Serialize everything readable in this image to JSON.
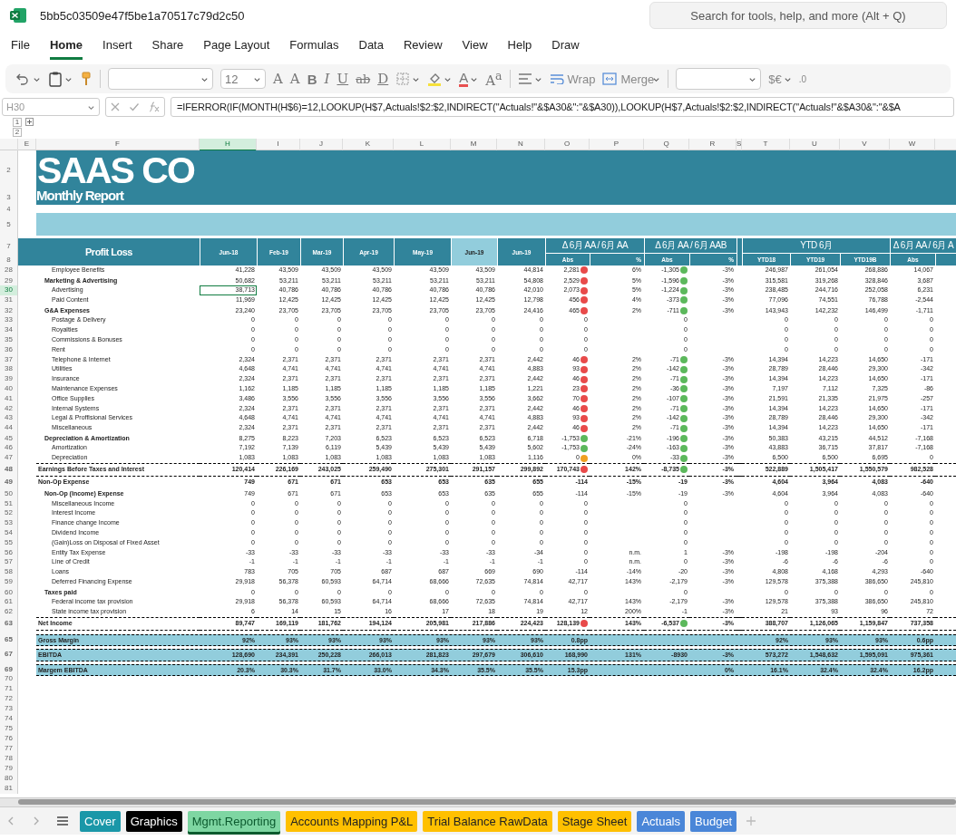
{
  "app": {
    "file_name": "5bb5c03509e47f5be1a70517c79d2c50",
    "search_placeholder": "Search for tools, help, and more (Alt + Q)"
  },
  "menu": [
    {
      "label": "File",
      "selected": false
    },
    {
      "label": "Home",
      "selected": true
    },
    {
      "label": "Insert",
      "selected": false
    },
    {
      "label": "Share",
      "selected": false
    },
    {
      "label": "Page Layout",
      "selected": false
    },
    {
      "label": "Formulas",
      "selected": false
    },
    {
      "label": "Data",
      "selected": false
    },
    {
      "label": "Review",
      "selected": false
    },
    {
      "label": "View",
      "selected": false
    },
    {
      "label": "Help",
      "selected": false
    },
    {
      "label": "Draw",
      "selected": false
    }
  ],
  "ribbon": {
    "font_size": "12",
    "font_buttons": [
      "A",
      "A",
      "B",
      "I",
      "U",
      "ab",
      "D"
    ],
    "color_a": "A",
    "text_effect": "A$^{a}$",
    "wrap": "Wrap",
    "merge": "Merge",
    "number_format": "$€",
    "decimal": ".0"
  },
  "formula_bar": {
    "cell_ref": "H30",
    "formula": "=IFERROR(IF(MONTH(H$6)=12,LOOKUP(H$7,Actuals!$2:$2,INDIRECT(\"Actuals!\"&$A30&\":\"&$A30)),LOOKUP(H$7,Actuals!$2:$2,INDIRECT(\"Actuals!\"&$A30&\":\"&$A"
  },
  "outline_levels": [
    "1",
    "2"
  ],
  "columns": [
    {
      "letter": "E",
      "selected": false
    },
    {
      "letter": "F",
      "selected": false
    },
    {
      "letter": "H",
      "selected": true
    },
    {
      "letter": "I",
      "selected": false
    },
    {
      "letter": "J",
      "selected": false
    },
    {
      "letter": "K",
      "selected": false
    },
    {
      "letter": "L",
      "selected": false
    },
    {
      "letter": "M",
      "selected": false
    },
    {
      "letter": "N",
      "selected": false
    },
    {
      "letter": "O",
      "selected": false
    },
    {
      "letter": "P",
      "selected": false
    },
    {
      "letter": "Q",
      "selected": false
    },
    {
      "letter": "R",
      "selected": false
    },
    {
      "letter": "S",
      "selected": false
    },
    {
      "letter": "T",
      "selected": false
    },
    {
      "letter": "U",
      "selected": false
    },
    {
      "letter": "V",
      "selected": false
    },
    {
      "letter": "W",
      "selected": false
    }
  ],
  "banner": {
    "rows": [
      "2",
      "3",
      "4",
      "5",
      "7",
      "8"
    ],
    "title": "SAAS CO",
    "subtitle": "Monthly Report"
  },
  "header": {
    "label": "Profit Loss",
    "months": [
      {
        "label": "Jun-18",
        "selected": false
      },
      {
        "label": "Feb-19",
        "selected": false
      },
      {
        "label": "Mar-19",
        "selected": false
      },
      {
        "label": "Apr-19",
        "selected": false
      },
      {
        "label": "May-19",
        "selected": false
      },
      {
        "label": "Jun-19",
        "selected": true
      },
      {
        "label": "Jun-19",
        "selected": false
      }
    ],
    "groups": [
      {
        "label": "Δ 6月 AA / 6月 AA",
        "subs": [
          "Abs",
          "%"
        ]
      },
      {
        "label": "Δ 6月 AA / 6月 AAB",
        "subs": [
          "Abs",
          "%"
        ]
      },
      {
        "label": "YTD 6月",
        "subs": [
          "YTD18",
          "YTD19",
          "YTD19B"
        ]
      },
      {
        "label": "Δ 6月 AA / 6月 A",
        "subs": [
          "Abs"
        ]
      }
    ]
  },
  "rows": [
    {
      "num": "28",
      "kind": "item",
      "label": "Employee Benefits",
      "selected": false,
      "cells": [
        "41,228",
        "43,509",
        "43,509",
        "43,509",
        "43,509",
        "43,509",
        "44,814",
        "2,281",
        "6%",
        "-1,305",
        "-3%",
        "246,987",
        "261,054",
        "268,886",
        "14,067"
      ],
      "o_dot": {
        "color": "#e84a4a"
      },
      "q_dot": {
        "color": "#5cb85c"
      }
    },
    {
      "num": "29",
      "kind": "group",
      "label": "Marketing & Advertising",
      "selected": false,
      "cells": [
        "50,682",
        "53,211",
        "53,211",
        "53,211",
        "53,211",
        "53,211",
        "54,808",
        "2,529",
        "5%",
        "-1,596",
        "-3%",
        "315,581",
        "319,268",
        "328,846",
        "3,687"
      ],
      "o_dot": {
        "color": "#e84a4a"
      },
      "q_dot": {
        "color": "#5cb85c"
      }
    },
    {
      "num": "30",
      "kind": "item",
      "label": "Advertising",
      "selected": true,
      "cells": [
        "38,713",
        "40,786",
        "40,786",
        "40,786",
        "40,786",
        "40,786",
        "42,010",
        "2,073",
        "5%",
        "-1,224",
        "-3%",
        "238,485",
        "244,716",
        "252,058",
        "6,231"
      ],
      "o_dot": {
        "color": "#e84a4a"
      },
      "q_dot": {
        "color": "#5cb85c"
      }
    },
    {
      "num": "31",
      "kind": "item",
      "label": "Paid Content",
      "selected": false,
      "cells": [
        "11,969",
        "12,425",
        "12,425",
        "12,425",
        "12,425",
        "12,425",
        "12,798",
        "456",
        "4%",
        "-373",
        "-3%",
        "77,096",
        "74,551",
        "76,788",
        "-2,544"
      ],
      "o_dot": {
        "color": "#e84a4a"
      },
      "q_dot": {
        "color": "#5cb85c"
      }
    },
    {
      "num": "32",
      "kind": "group",
      "label": "G&A Expenses",
      "selected": false,
      "cells": [
        "23,240",
        "23,705",
        "23,705",
        "23,705",
        "23,705",
        "23,705",
        "24,416",
        "465",
        "2%",
        "-711",
        "-3%",
        "143,943",
        "142,232",
        "146,499",
        "-1,711"
      ],
      "o_dot": {
        "color": "#e84a4a"
      },
      "q_dot": {
        "color": "#5cb85c"
      }
    },
    {
      "num": "33",
      "kind": "item",
      "label": "Postage & Delivery",
      "selected": false,
      "cells": [
        "0",
        "0",
        "0",
        "0",
        "0",
        "0",
        "0",
        "0",
        null,
        "0",
        null,
        "0",
        "0",
        "0",
        "0"
      ]
    },
    {
      "num": "34",
      "kind": "item",
      "label": "Royalties",
      "selected": false,
      "cells": [
        "0",
        "0",
        "0",
        "0",
        "0",
        "0",
        "0",
        "0",
        null,
        "0",
        null,
        "0",
        "0",
        "0",
        "0"
      ]
    },
    {
      "num": "35",
      "kind": "item",
      "label": "Commissions & Bonuses",
      "selected": false,
      "cells": [
        "0",
        "0",
        "0",
        "0",
        "0",
        "0",
        "0",
        "0",
        null,
        "0",
        null,
        "0",
        "0",
        "0",
        "0"
      ]
    },
    {
      "num": "36",
      "kind": "item",
      "label": "Rent",
      "selected": false,
      "cells": [
        "0",
        "0",
        "0",
        "0",
        "0",
        "0",
        "0",
        "0",
        null,
        "0",
        null,
        "0",
        "0",
        "0",
        "0"
      ]
    },
    {
      "num": "37",
      "kind": "item",
      "label": "Telephone & Internet",
      "selected": false,
      "cells": [
        "2,324",
        "2,371",
        "2,371",
        "2,371",
        "2,371",
        "2,371",
        "2,442",
        "46",
        "2%",
        "-71",
        "-3%",
        "14,394",
        "14,223",
        "14,650",
        "-171"
      ],
      "o_dot": {
        "color": "#e84a4a"
      },
      "q_dot": {
        "color": "#5cb85c"
      }
    },
    {
      "num": "38",
      "kind": "item",
      "label": "Utilities",
      "selected": false,
      "cells": [
        "4,648",
        "4,741",
        "4,741",
        "4,741",
        "4,741",
        "4,741",
        "4,883",
        "93",
        "2%",
        "-142",
        "-3%",
        "28,789",
        "28,446",
        "29,300",
        "-342"
      ],
      "o_dot": {
        "color": "#e84a4a"
      },
      "q_dot": {
        "color": "#5cb85c"
      }
    },
    {
      "num": "39",
      "kind": "item",
      "label": "Insurance",
      "selected": false,
      "cells": [
        "2,324",
        "2,371",
        "2,371",
        "2,371",
        "2,371",
        "2,371",
        "2,442",
        "46",
        "2%",
        "-71",
        "-3%",
        "14,394",
        "14,223",
        "14,650",
        "-171"
      ],
      "o_dot": {
        "color": "#e84a4a"
      },
      "q_dot": {
        "color": "#5cb85c"
      }
    },
    {
      "num": "40",
      "kind": "item",
      "label": "Maintenance Expenses",
      "selected": false,
      "cells": [
        "1,162",
        "1,185",
        "1,185",
        "1,185",
        "1,185",
        "1,185",
        "1,221",
        "23",
        "2%",
        "-36",
        "-3%",
        "7,197",
        "7,112",
        "7,325",
        "-86"
      ],
      "o_dot": {
        "color": "#e84a4a"
      },
      "q_dot": {
        "color": "#5cb85c"
      }
    },
    {
      "num": "41",
      "kind": "item",
      "label": "Office Supplies",
      "selected": false,
      "cells": [
        "3,486",
        "3,556",
        "3,556",
        "3,556",
        "3,556",
        "3,556",
        "3,662",
        "70",
        "2%",
        "-107",
        "-3%",
        "21,591",
        "21,335",
        "21,975",
        "-257"
      ],
      "o_dot": {
        "color": "#e84a4a"
      },
      "q_dot": {
        "color": "#5cb85c"
      }
    },
    {
      "num": "42",
      "kind": "item",
      "label": "Internal Systems",
      "selected": false,
      "cells": [
        "2,324",
        "2,371",
        "2,371",
        "2,371",
        "2,371",
        "2,371",
        "2,442",
        "46",
        "2%",
        "-71",
        "-3%",
        "14,394",
        "14,223",
        "14,650",
        "-171"
      ],
      "o_dot": {
        "color": "#e84a4a"
      },
      "q_dot": {
        "color": "#5cb85c"
      }
    },
    {
      "num": "43",
      "kind": "item",
      "label": "Legal & Proffisional Services",
      "selected": false,
      "cells": [
        "4,648",
        "4,741",
        "4,741",
        "4,741",
        "4,741",
        "4,741",
        "4,883",
        "93",
        "2%",
        "-142",
        "-3%",
        "28,789",
        "28,446",
        "29,300",
        "-342"
      ],
      "o_dot": {
        "color": "#e84a4a"
      },
      "q_dot": {
        "color": "#5cb85c"
      }
    },
    {
      "num": "44",
      "kind": "item",
      "label": "Miscellaneous",
      "selected": false,
      "cells": [
        "2,324",
        "2,371",
        "2,371",
        "2,371",
        "2,371",
        "2,371",
        "2,442",
        "46",
        "2%",
        "-71",
        "-3%",
        "14,394",
        "14,223",
        "14,650",
        "-171"
      ],
      "o_dot": {
        "color": "#e84a4a"
      },
      "q_dot": {
        "color": "#5cb85c"
      }
    },
    {
      "num": "45",
      "kind": "group",
      "label": "Depreciation & Amortization",
      "selected": false,
      "cells": [
        "8,275",
        "8,223",
        "7,203",
        "6,523",
        "6,523",
        "6,523",
        "6,718",
        "-1,753",
        "-21%",
        "-196",
        "-3%",
        "50,383",
        "43,215",
        "44,512",
        "-7,168"
      ],
      "o_dot": {
        "color": "#5cb85c"
      },
      "q_dot": {
        "color": "#5cb85c"
      }
    },
    {
      "num": "46",
      "kind": "item",
      "label": "Amortization",
      "selected": false,
      "cells": [
        "7,192",
        "7,139",
        "6,119",
        "5,439",
        "5,439",
        "5,439",
        "5,602",
        "-1,753",
        "-24%",
        "-163",
        "-3%",
        "43,883",
        "36,715",
        "37,817",
        "-7,168"
      ],
      "o_dot": {
        "color": "#5cb85c"
      },
      "q_dot": {
        "color": "#5cb85c"
      }
    },
    {
      "num": "47",
      "kind": "item",
      "label": "Depreciation",
      "selected": false,
      "rule_below": true,
      "cells": [
        "1,083",
        "1,083",
        "1,083",
        "1,083",
        "1,083",
        "1,083",
        "1,116",
        "0",
        "0%",
        "-33",
        "-3%",
        "6,500",
        "6,500",
        "6,695",
        "0"
      ],
      "o_dot": {
        "color": "#f0a020"
      },
      "q_dot": {
        "color": "#5cb85c"
      }
    },
    {
      "num": "48",
      "kind": "total",
      "label": "Earnings Before Taxes and Interest",
      "selected": false,
      "rule_below": true,
      "cells": [
        "120,414",
        "226,169",
        "243,025",
        "259,490",
        "275,301",
        "291,157",
        "299,892",
        "170,743",
        "142%",
        "-8,735",
        "-3%",
        "522,889",
        "1,505,417",
        "1,550,579",
        "982,528"
      ],
      "o_dot": {
        "color": "#e84a4a"
      },
      "q_dot": {
        "color": "#5cb85c"
      }
    },
    {
      "num": "49",
      "kind": "total",
      "label": "Non-Op Expense",
      "selected": false,
      "cells": [
        "749",
        "671",
        "671",
        "653",
        "653",
        "635",
        "655",
        "-114",
        "-15%",
        "-19",
        "-3%",
        "4,604",
        "3,964",
        "4,083",
        "-640"
      ]
    },
    {
      "num": "50",
      "kind": "group",
      "label": "Non-Op (Income) Expense",
      "selected": false,
      "cells": [
        "749",
        "671",
        "671",
        "653",
        "653",
        "635",
        "655",
        "-114",
        "-15%",
        "-19",
        "-3%",
        "4,604",
        "3,964",
        "4,083",
        "-640"
      ]
    },
    {
      "num": "51",
      "kind": "item",
      "label": "Miscellaneous Income",
      "selected": false,
      "cells": [
        "0",
        "0",
        "0",
        "0",
        "0",
        "0",
        "0",
        "0",
        null,
        "0",
        null,
        "0",
        "0",
        "0",
        "0"
      ]
    },
    {
      "num": "52",
      "kind": "item",
      "label": "Interest Income",
      "selected": false,
      "cells": [
        "0",
        "0",
        "0",
        "0",
        "0",
        "0",
        "0",
        "0",
        null,
        "0",
        null,
        "0",
        "0",
        "0",
        "0"
      ]
    },
    {
      "num": "53",
      "kind": "item",
      "label": "Finance change Income",
      "selected": false,
      "cells": [
        "0",
        "0",
        "0",
        "0",
        "0",
        "0",
        "0",
        "0",
        null,
        "0",
        null,
        "0",
        "0",
        "0",
        "0"
      ]
    },
    {
      "num": "54",
      "kind": "item",
      "label": "Dividend Income",
      "selected": false,
      "cells": [
        "0",
        "0",
        "0",
        "0",
        "0",
        "0",
        "0",
        "0",
        null,
        "0",
        null,
        "0",
        "0",
        "0",
        "0"
      ]
    },
    {
      "num": "55",
      "kind": "item",
      "label": "(Gain)Loss on Disposal of Fixed Asset",
      "selected": false,
      "cells": [
        "0",
        "0",
        "0",
        "0",
        "0",
        "0",
        "0",
        "0",
        null,
        "0",
        null,
        "0",
        "0",
        "0",
        "0"
      ]
    },
    {
      "num": "56",
      "kind": "item",
      "label": "Entity Tax Expense",
      "selected": false,
      "cells": [
        "-33",
        "-33",
        "-33",
        "-33",
        "-33",
        "-33",
        "-34",
        "0",
        "n.m.",
        "1",
        "-3%",
        "-198",
        "-198",
        "-204",
        "0"
      ]
    },
    {
      "num": "57",
      "kind": "item",
      "label": "Line of Credit",
      "selected": false,
      "cells": [
        "-1",
        "-1",
        "-1",
        "-1",
        "-1",
        "-1",
        "-1",
        "0",
        "n.m.",
        "0",
        "-3%",
        "-6",
        "-6",
        "-6",
        "0"
      ]
    },
    {
      "num": "58",
      "kind": "item",
      "label": "Loans",
      "selected": false,
      "cells": [
        "783",
        "705",
        "705",
        "687",
        "687",
        "669",
        "690",
        "-114",
        "-14%",
        "-20",
        "-3%",
        "4,808",
        "4,168",
        "4,293",
        "-640"
      ]
    },
    {
      "num": "59",
      "kind": "item",
      "label": "Deferred Financing Expense",
      "selected": false,
      "cells": [
        "29,918",
        "56,378",
        "60,593",
        "64,714",
        "68,666",
        "72,635",
        "74,814",
        "42,717",
        "143%",
        "-2,179",
        "-3%",
        "129,578",
        "375,388",
        "386,650",
        "245,810"
      ]
    },
    {
      "num": "60",
      "kind": "group",
      "label": "Taxes paid",
      "selected": false,
      "cells": [
        "0",
        "0",
        "0",
        "0",
        "0",
        "0",
        "0",
        "0",
        null,
        "0",
        null,
        "0",
        "0",
        "0",
        "0"
      ]
    },
    {
      "num": "61",
      "kind": "item",
      "label": "Federal income tax provision",
      "selected": false,
      "cells": [
        "29,918",
        "56,378",
        "60,593",
        "64,714",
        "68,666",
        "72,635",
        "74,814",
        "42,717",
        "143%",
        "-2,179",
        "-3%",
        "129,578",
        "375,388",
        "386,650",
        "245,810"
      ]
    },
    {
      "num": "62",
      "kind": "item",
      "label": "State income tax provision",
      "selected": false,
      "rule_below": true,
      "cells": [
        "6",
        "14",
        "15",
        "16",
        "17",
        "18",
        "19",
        "12",
        "200%",
        "-1",
        "-3%",
        "21",
        "93",
        "96",
        "72"
      ]
    },
    {
      "num": "63",
      "kind": "total",
      "label": "Net Income",
      "selected": false,
      "rule_below": true,
      "cells": [
        "89,747",
        "169,119",
        "181,762",
        "194,124",
        "205,981",
        "217,886",
        "224,423",
        "128,139",
        "143%",
        "-6,537",
        "-3%",
        "388,707",
        "1,126,065",
        "1,159,847",
        "737,358"
      ],
      "o_dot": {
        "color": "#e84a4a"
      },
      "q_dot": {
        "color": "#5cb85c"
      }
    },
    {
      "kind": "spacer"
    },
    {
      "num": "65",
      "kind": "band",
      "label": "Gross Margin",
      "selected": false,
      "cells": [
        "92%",
        "93%",
        "93%",
        "93%",
        "93%",
        "93%",
        "93%",
        "0.8pp",
        null,
        null,
        null,
        "92%",
        "93%",
        "93%",
        "0.6pp"
      ]
    },
    {
      "kind": "spacer"
    },
    {
      "num": "67",
      "kind": "band",
      "label": "EBITDA",
      "selected": false,
      "cells": [
        "128,690",
        "234,391",
        "250,228",
        "266,013",
        "281,823",
        "297,679",
        "306,610",
        "168,990",
        "131%",
        "-8930",
        "-3%",
        "573,272",
        "1,548,632",
        "1,595,091",
        "975,361"
      ]
    },
    {
      "kind": "spacer"
    },
    {
      "num": "69",
      "kind": "band",
      "label": "Margem EBITDA",
      "selected": false,
      "cells": [
        "20.3%",
        "30.3%",
        "31.7%",
        "33.0%",
        "34.3%",
        "35.5%",
        "35.5%",
        "15.3pp",
        null,
        null,
        "0%",
        "16.1%",
        "32.4%",
        "32.4%",
        "16.2pp"
      ]
    }
  ],
  "empty_rows": [
    "70",
    "71",
    "72",
    "73",
    "74",
    "75",
    "76",
    "77",
    "78",
    "79",
    "80",
    "81"
  ],
  "sheet_tabs": [
    {
      "label": "Cover",
      "color": "#1a97a8",
      "selected": false
    },
    {
      "label": "Graphics",
      "color": "#000000",
      "selected": false
    },
    {
      "label": "Mgmt.Reporting",
      "color": "#7ed6a2",
      "selected": true
    },
    {
      "label": "Accounts Mapping P&L",
      "color": "#ffc000",
      "selected": false
    },
    {
      "label": "Trial Balance RawData",
      "color": "#ffc000",
      "selected": false
    },
    {
      "label": "Stage Sheet",
      "color": "#ffc000",
      "selected": false
    },
    {
      "label": "Actuals",
      "color": "#4a86d8",
      "selected": false
    },
    {
      "label": "Budget",
      "color": "#4a86d8",
      "selected": false
    }
  ]
}
